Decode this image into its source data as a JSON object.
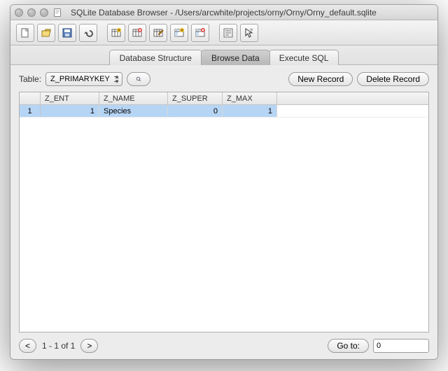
{
  "window": {
    "title": "SQLite Database Browser - /Users/arcwhite/projects/orny/Orny/Orny_default.sqlite"
  },
  "tabs": {
    "structure": "Database Structure",
    "browse": "Browse Data",
    "sql": "Execute SQL",
    "active": "browse"
  },
  "toolbar_labels": {
    "new": "new-file",
    "open": "open-file",
    "save": "save-file",
    "undo": "undo",
    "t1": "create-table",
    "t2": "drop-table",
    "t3": "modify-table",
    "t4": "create-index",
    "t5": "drop-index",
    "log": "sql-log",
    "help": "whats-this"
  },
  "browse": {
    "table_label": "Table:",
    "table_selected": "Z_PRIMARYKEY",
    "new_record": "New Record",
    "delete_record": "Delete Record"
  },
  "grid": {
    "headers": {
      "rownum": "",
      "c0": "Z_ENT",
      "c1": "Z_NAME",
      "c2": "Z_SUPER",
      "c3": "Z_MAX"
    },
    "rows": [
      {
        "n": "1",
        "c0": "1",
        "c1": "Species",
        "c2": "0",
        "c3": "1"
      }
    ]
  },
  "footer": {
    "prev": "<",
    "range": "1 - 1 of 1",
    "next": ">",
    "goto_label": "Go to:",
    "goto_value": "0"
  }
}
